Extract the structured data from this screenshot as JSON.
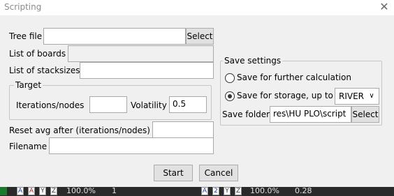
{
  "window": {
    "title": "Scripting"
  },
  "tree_file": {
    "label": "Tree file",
    "value": "",
    "button": "Select"
  },
  "list_of_boards": {
    "label": "List of boards",
    "value": ""
  },
  "list_of_stacksizes": {
    "label": "List of stacksizes",
    "value": ""
  },
  "target": {
    "legend": "Target",
    "iterations_label": "Iterations/nodes",
    "iterations_value": "",
    "volatility_label": "Volatility",
    "volatility_value": "0.5"
  },
  "reset_avg": {
    "label": "Reset avg after (iterations/nodes)",
    "value": ""
  },
  "filename": {
    "label": "Filename",
    "value": ""
  },
  "save_settings": {
    "legend": "Save settings",
    "option_further": "Save for further calculation",
    "option_storage": "Save for storage, up to",
    "street_selected": "RIVER",
    "folder_label": "Save folder",
    "folder_value": "res\\HU PLO\\script",
    "folder_button": "Select"
  },
  "actions": {
    "start": "Start",
    "cancel": "Cancel"
  },
  "background_strip": {
    "text_left": "100.0%",
    "num_left": "1",
    "text_right": "100.0%",
    "num_right": "0.28"
  }
}
